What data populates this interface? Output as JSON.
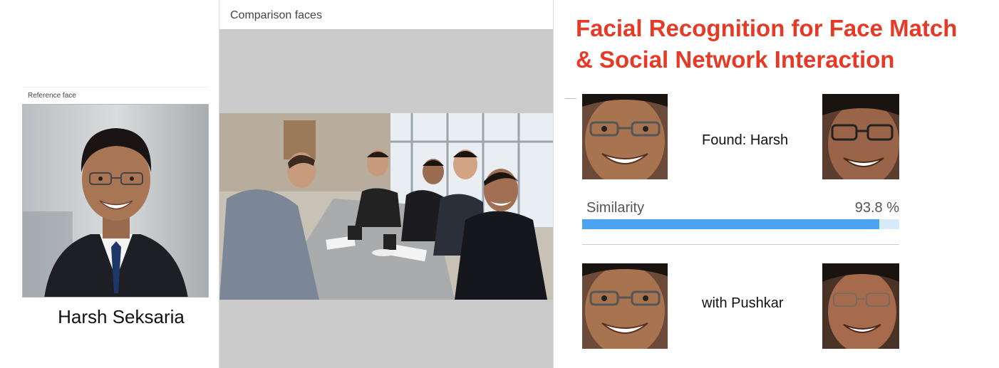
{
  "reference": {
    "label": "Reference face",
    "name": "Harsh Seksaria"
  },
  "comparison": {
    "title": "Comparison faces"
  },
  "headline": {
    "line1": "Facial Recognition for Face Match",
    "line2": "& Social Network Interaction"
  },
  "match": {
    "found_text": "Found: Harsh",
    "similarity_label": "Similarity",
    "similarity_value": "93.8 %",
    "similarity_fraction": 0.938,
    "with_text": "with Pushkar"
  },
  "colors": {
    "headline": "#e63a26",
    "bar_fill": "#4ca3f0",
    "bar_track": "#d7ebfb"
  }
}
